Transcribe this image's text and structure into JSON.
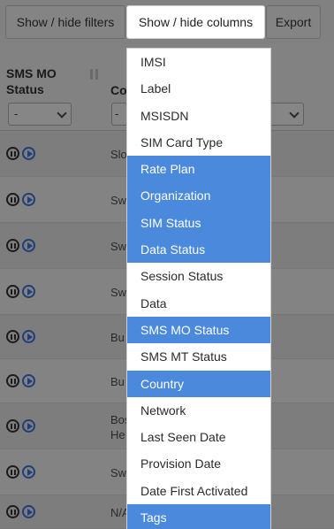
{
  "toolbar": {
    "filters_label": "Show / hide filters",
    "columns_label": "Show / hide columns",
    "export_label": "Export"
  },
  "table": {
    "headers": {
      "sms_mo_status_line1": "SMS MO",
      "sms_mo_status_line2": "Status",
      "next_column_partial": "Co"
    },
    "filter_value": "-",
    "filter_value_partial": "-",
    "rows": [
      {
        "line1": "Slo",
        "line2": ""
      },
      {
        "line1": "Sw",
        "line2": ""
      },
      {
        "line1": "Sw",
        "line2": ""
      },
      {
        "line1": "Sw",
        "line2": ""
      },
      {
        "line1": "Bu",
        "line2": ""
      },
      {
        "line1": "Bu",
        "line2": ""
      },
      {
        "line1": "Bos",
        "line2": "He"
      },
      {
        "line1": "Sw",
        "line2": ""
      },
      {
        "line1": "N/A",
        "line2": ""
      }
    ]
  },
  "columns_menu": {
    "items": [
      {
        "label": "IMSI",
        "selected": false
      },
      {
        "label": "Label",
        "selected": false
      },
      {
        "label": "MSISDN",
        "selected": false
      },
      {
        "label": "SIM Card Type",
        "selected": false
      },
      {
        "label": "Rate Plan",
        "selected": true
      },
      {
        "label": "Organization",
        "selected": true
      },
      {
        "label": "SIM Status",
        "selected": true
      },
      {
        "label": "Data Status",
        "selected": true
      },
      {
        "label": "Session Status",
        "selected": false
      },
      {
        "label": "Data",
        "selected": false
      },
      {
        "label": "SMS MO Status",
        "selected": true
      },
      {
        "label": "SMS MT Status",
        "selected": false
      },
      {
        "label": "Country",
        "selected": true
      },
      {
        "label": "Network",
        "selected": false
      },
      {
        "label": "Last Seen Date",
        "selected": false
      },
      {
        "label": "Provision Date",
        "selected": false
      },
      {
        "label": "Date First Activated",
        "selected": false
      },
      {
        "label": "Tags",
        "selected": true
      }
    ],
    "selected_color": "#4a89dc"
  }
}
